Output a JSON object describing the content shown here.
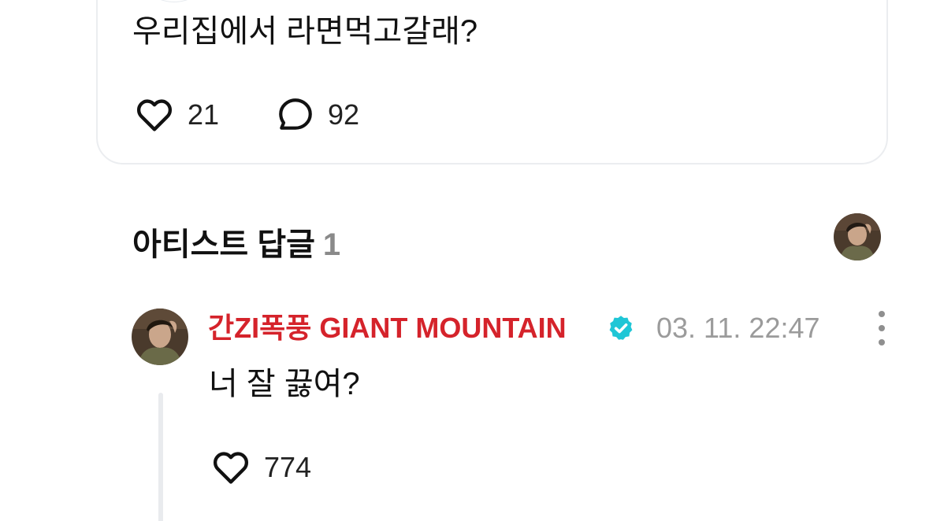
{
  "post": {
    "text": "우리집에서 라면먹고갈래?",
    "likes": "21",
    "comments": "92"
  },
  "artist_replies": {
    "title": "아티스트 답글",
    "count": "1"
  },
  "reply": {
    "author": "간ZI폭풍 GIANT MOUNTAIN",
    "timestamp": "03. 11. 22:47",
    "text": "너 잘 끓여?",
    "likes": "774"
  },
  "colors": {
    "author_name": "#d5232b",
    "verified_badge": "#1fc6d6",
    "muted_text": "#9b9b9b",
    "card_border": "#ebedf0"
  },
  "icons": {
    "like": "heart-outline-icon",
    "comment": "speech-bubble-icon",
    "verified": "verified-badge-icon",
    "more": "more-vertical-icon"
  }
}
